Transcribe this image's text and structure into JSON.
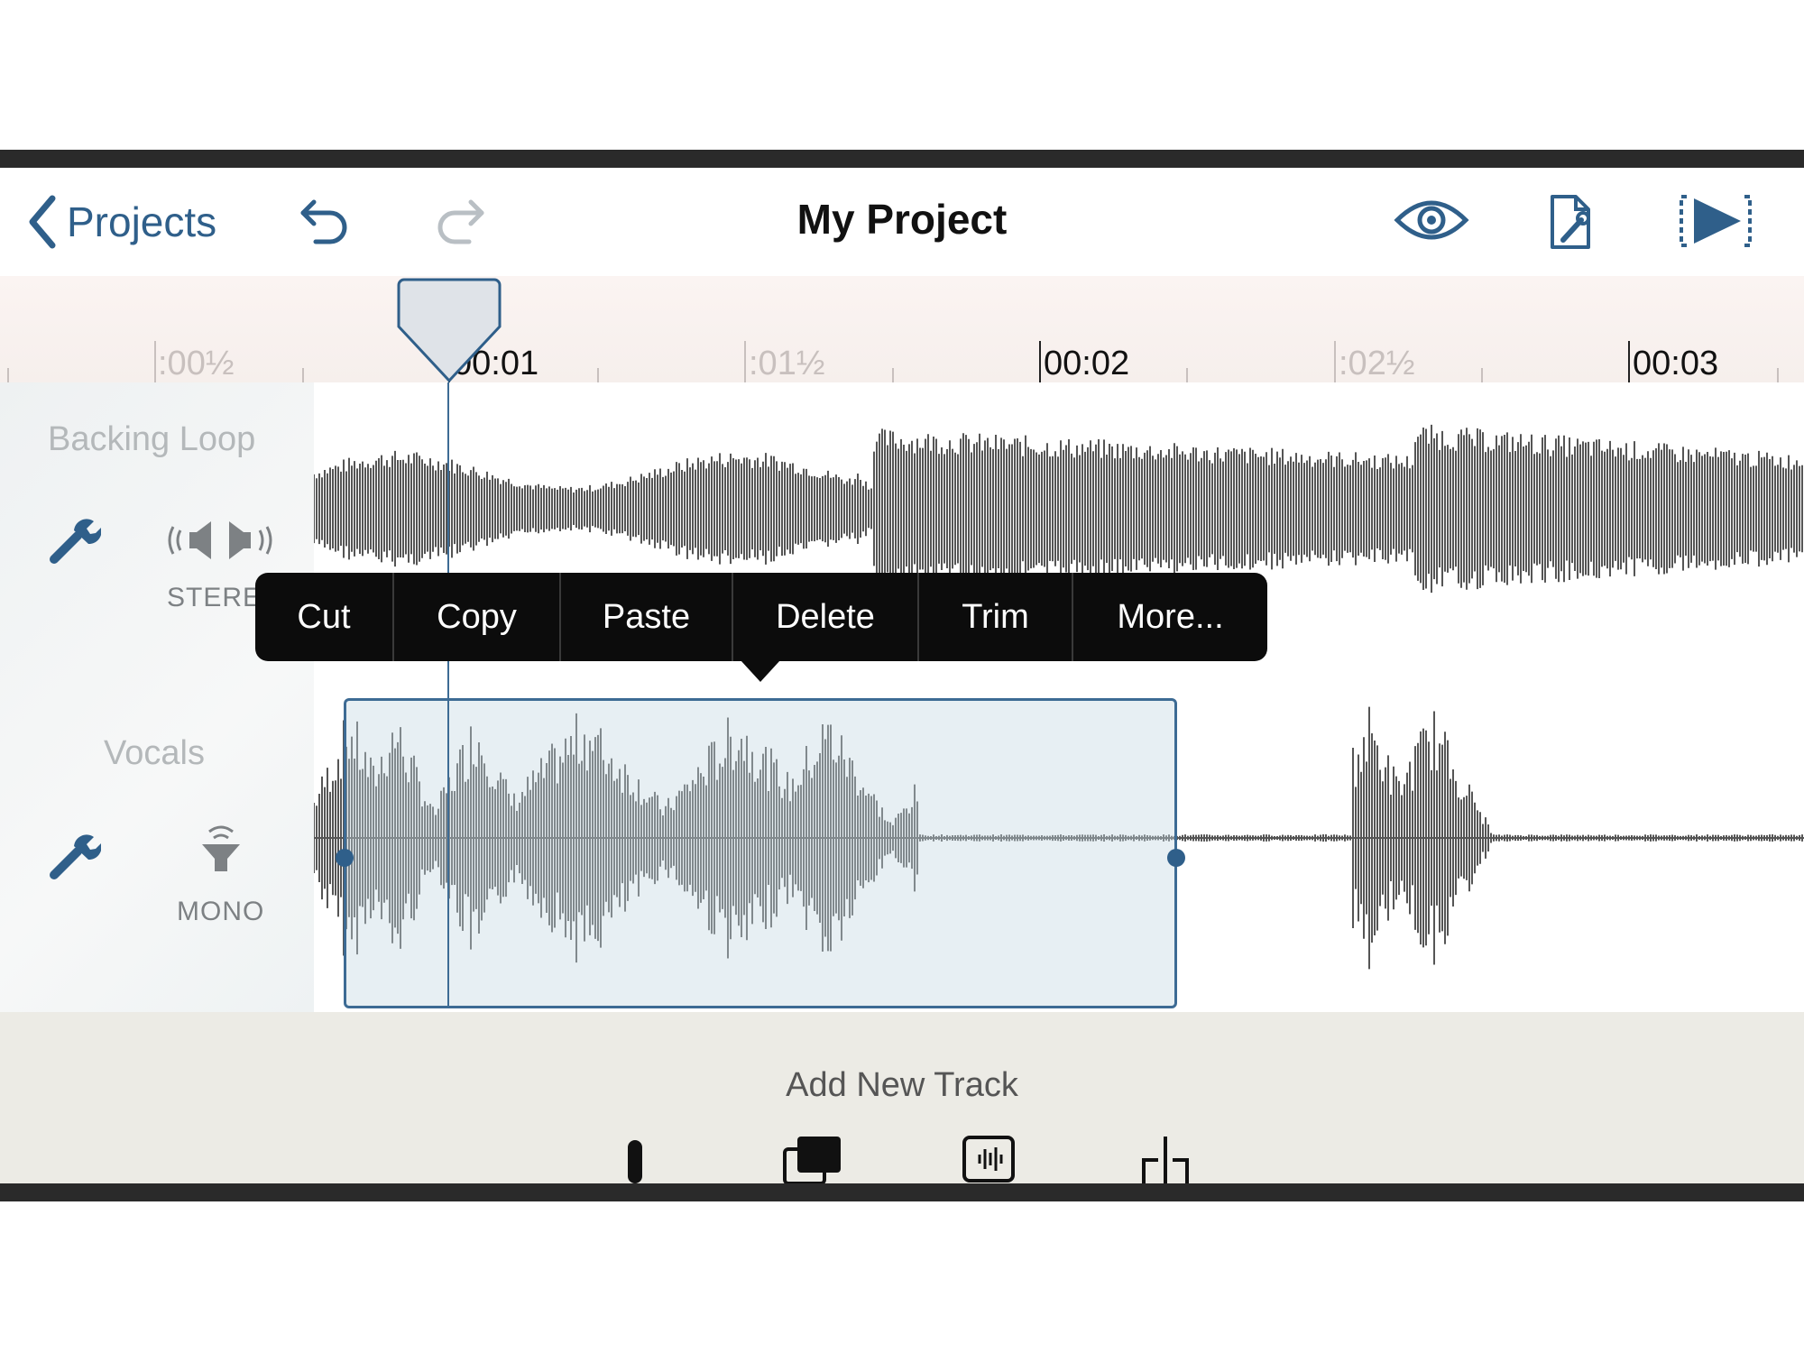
{
  "toolbar": {
    "back_label": "Projects",
    "title": "My Project",
    "icons": {
      "back": "chevron-left-icon",
      "undo": "undo-icon",
      "redo": "redo-icon",
      "preview": "eye-icon",
      "settings": "document-settings-icon",
      "export": "export-video-icon"
    }
  },
  "ruler": {
    "labels": [
      ":00½",
      "00:01",
      ":01½",
      "00:02",
      ":02½",
      "00:03"
    ]
  },
  "tracks": [
    {
      "name": "Backing Loop",
      "channel": "STEREO"
    },
    {
      "name": "Vocals",
      "channel": "MONO"
    }
  ],
  "context_menu": {
    "items": [
      "Cut",
      "Copy",
      "Paste",
      "Delete",
      "Trim",
      "More..."
    ]
  },
  "add_track": {
    "label": "Add New Track"
  },
  "colors": {
    "accent": "#2f5f8a",
    "waveform": "#555555",
    "selection": "#c4d6e2",
    "menu_bg": "#0c0c0c"
  }
}
